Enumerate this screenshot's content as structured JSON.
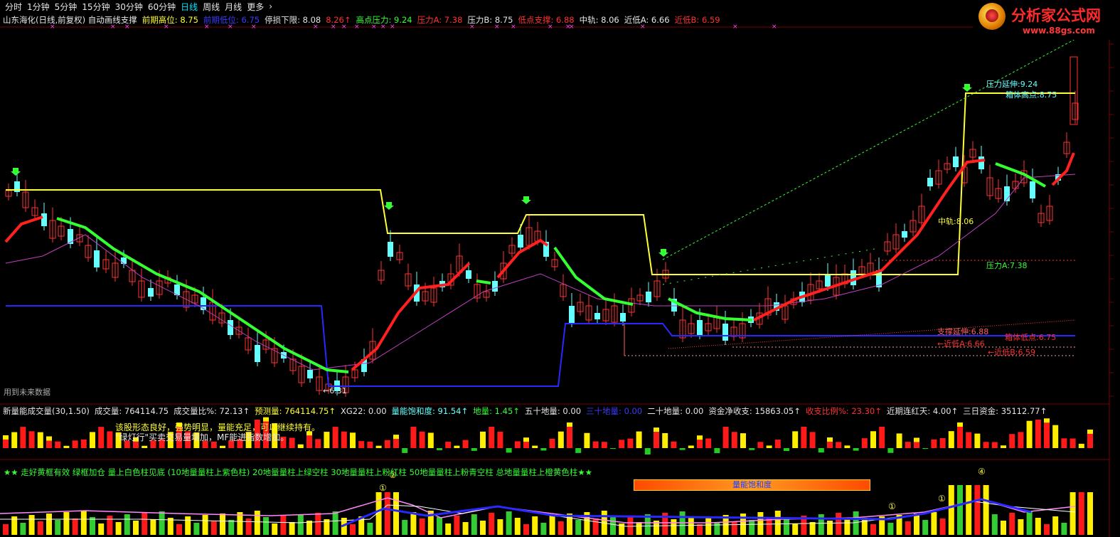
{
  "tabs": [
    "分时",
    "1分钟",
    "5分钟",
    "15分钟",
    "30分钟",
    "60分钟",
    "日线",
    "周线",
    "月线",
    "更多",
    "›"
  ],
  "active_tab": "日线",
  "logo": {
    "name": "分析家公式网",
    "url": "www.88gs.com"
  },
  "colors": {
    "yellow": "#ffff33",
    "red": "#ff2020",
    "green": "#33ff33",
    "cyan": "#66ffff",
    "blue": "#2828ff",
    "magenta": "#cc44cc",
    "white": "#e6e6e6"
  },
  "top_header": [
    {
      "text": "山东海化(日线,前复权) 自动画线支撑",
      "color": "#e6e6e6"
    },
    {
      "text": "前期高位: 8.75",
      "color": "#ffff33"
    },
    {
      "text": "前期低位: 6.75",
      "color": "#3a3aff"
    },
    {
      "text": "停损下限: 8.08",
      "color": "#e6e6e6"
    },
    {
      "text": "8.26↑",
      "color": "#ff3030"
    },
    {
      "text": "高点压力: 9.24",
      "color": "#33ff33"
    },
    {
      "text": "压力A: 7.38",
      "color": "#ff3030"
    },
    {
      "text": "压力B: 8.75",
      "color": "#e6e6e6"
    },
    {
      "text": "低点支撑: 6.88",
      "color": "#ff3030"
    },
    {
      "text": "中轨: 8.06",
      "color": "#e6e6e6"
    },
    {
      "text": "近低A: 6.66",
      "color": "#e6e6e6"
    },
    {
      "text": "近低B: 6.59",
      "color": "#ff3030"
    }
  ],
  "chart_labels": {
    "pressure_ext": "压力延伸:9.24",
    "box_high": "箱体高点:8.75",
    "mid": "中轨:8.06",
    "pressure_a": "压力A:7.38",
    "support_ext": "支撑延伸:6.88",
    "box_low": "箱体低点:6.75",
    "near_low_a": "←近低A:6.66",
    "near_low_b": "←近低B:6.59",
    "low_mark": "←6.31",
    "future_note": "用到未来数据"
  },
  "vol_header": [
    {
      "text": "新量能成交量(30,1.50)",
      "color": "#e6e6e6"
    },
    {
      "text": "成交量: 764114.75",
      "color": "#e6e6e6"
    },
    {
      "text": "成交量比%: 72.13↑",
      "color": "#e6e6e6"
    },
    {
      "text": "预测量: 764114.75↑",
      "color": "#ffff33"
    },
    {
      "text": "XG22: 0.00",
      "color": "#e6e6e6"
    },
    {
      "text": "量能饱和度: 91.54↑",
      "color": "#66ffff"
    },
    {
      "text": "地量: 1.45↑",
      "color": "#33ff33"
    },
    {
      "text": "五十地量: 0.00",
      "color": "#e6e6e6"
    },
    {
      "text": "三十地量: 0.00",
      "color": "#3a3aff"
    },
    {
      "text": "二十地量: 0.00",
      "color": "#e6e6e6"
    },
    {
      "text": "资金净收支: 15863.05↑",
      "color": "#e6e6e6"
    },
    {
      "text": "收支比例%: 23.30↑",
      "color": "#ff3030"
    },
    {
      "text": "近期连红天: 4.00↑",
      "color": "#e6e6e6"
    },
    {
      "text": "三日资金: 35112.77↑",
      "color": "#e6e6e6"
    }
  ],
  "vol_notes": {
    "line1": "该股形态良好，强势明显，量能充足，可以继续持有。",
    "line2": "\"绿灯行\"买卖交易量增加，MF能进指数增加。"
  },
  "legend_line": "★★ 走好黄框有效 绿框加仓 量上白色柱见底 (10地量量柱上紫色柱) 20地量量柱上绿空柱 30地量量柱上粉红柱 50地量量柱上粉青空柱 总地量量柱上橙黄色柱★★",
  "saturation_bar": {
    "label": "量能饱和度",
    "value": 91.54
  },
  "circle_marks": [
    "①",
    "②",
    "①",
    "①",
    "④"
  ]
}
